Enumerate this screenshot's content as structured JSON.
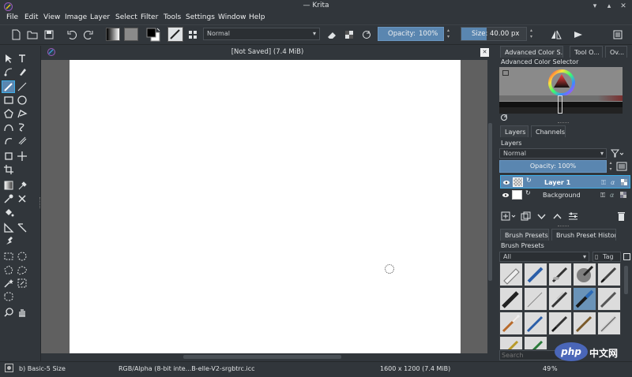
{
  "window": {
    "title": "— Krita"
  },
  "menu": [
    "File",
    "Edit",
    "View",
    "Image",
    "Layer",
    "Select",
    "Filter",
    "Tools",
    "Settings",
    "Window",
    "Help"
  ],
  "toolbar": {
    "blend_mode": "Normal",
    "opacity_label": "Opacity:",
    "opacity_value": "100%",
    "size_label": "Size:",
    "size_value": "40.00 px"
  },
  "document": {
    "title": "[Not Saved]  (7.4 MiB)"
  },
  "docker": {
    "tabs": [
      "Advanced Color S...",
      "Tool O...",
      "Ov..."
    ],
    "color_selector_title": "Advanced Color Selector",
    "layers_tabs": [
      "Layers",
      "Channels"
    ],
    "layers_title": "Layers",
    "layers_blend_mode": "Normal",
    "layers_opacity": "Opacity:  100%",
    "layers": [
      {
        "name": "Layer 1",
        "selected": true
      },
      {
        "name": "Background",
        "selected": false
      }
    ],
    "brush_tabs": [
      "Brush Presets",
      "Brush Preset History"
    ],
    "brush_title": "Brush Presets",
    "brush_filter": "All",
    "brush_tag": "Tag",
    "search_placeholder": "Search"
  },
  "status": {
    "brush": "b) Basic-5 Size",
    "color_space": "RGB/Alpha (8-bit inte...B-elle-V2-srgbtrc.icc",
    "dimensions": "1600 x 1200 (7.4 MiB)",
    "zoom": "49"
  },
  "watermark": {
    "text": "php",
    "text2": "中文网"
  },
  "colors": {
    "background": "#31363b",
    "accent": "#3daee9",
    "selection": "#5a86b0",
    "canvas_surround": "#606060"
  }
}
